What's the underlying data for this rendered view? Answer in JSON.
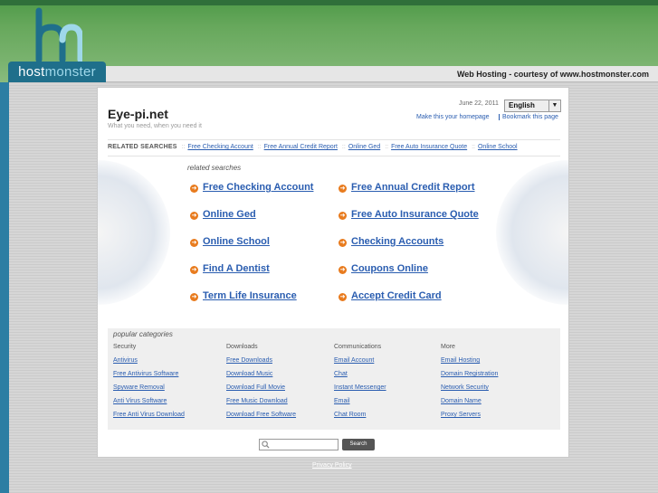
{
  "header": {
    "brand_host": "host",
    "brand_monster": "monster",
    "courtesy": "Web Hosting - courtesy of www.hostmonster.com"
  },
  "site": {
    "title": "Eye-pi.net",
    "tagline": "What you need, when you need it",
    "date": "June 22, 2011",
    "language": "English",
    "homepage_link": "Make this your homepage",
    "bookmark_link": "Bookmark this page"
  },
  "related_bar": {
    "label": "RELATED SEARCHES",
    "items": [
      "Free Checking Account",
      "Free Annual Credit Report",
      "Online Ged",
      "Free Auto Insurance Quote",
      "Online School"
    ]
  },
  "related": {
    "heading": "related searches",
    "left": [
      "Free Checking Account",
      "Online Ged",
      "Online School",
      "Find A Dentist",
      "Term Life Insurance"
    ],
    "right": [
      "Free Annual Credit Report",
      "Free Auto Insurance Quote",
      "Checking Accounts",
      "Coupons Online",
      "Accept Credit Card"
    ]
  },
  "popular": {
    "title": "popular categories",
    "columns": [
      {
        "heading": "Security",
        "items": [
          "Antivirus",
          "Free Antivirus Software",
          "Spyware Removal",
          "Anti Virus Software",
          "Free Anti Virus Download"
        ]
      },
      {
        "heading": "Downloads",
        "items": [
          "Free Downloads",
          "Download Music",
          "Download Full Movie",
          "Free Music Download",
          "Download Free Software"
        ]
      },
      {
        "heading": "Communications",
        "items": [
          "Email Account",
          "Chat",
          "Instant Messenger",
          "Email",
          "Chat Room"
        ]
      },
      {
        "heading": "More",
        "items": [
          "Email Hosting",
          "Domain Registration",
          "Network Security",
          "Domain Name",
          "Proxy Servers"
        ]
      }
    ]
  },
  "search": {
    "button": "Search",
    "value": ""
  },
  "footer": {
    "privacy": "Privacy Policy"
  },
  "colors": {
    "link": "#2a5db0",
    "bullet": "#e87b1e",
    "brand_blue": "#1f6f8b",
    "header_green": "#67a85c"
  }
}
